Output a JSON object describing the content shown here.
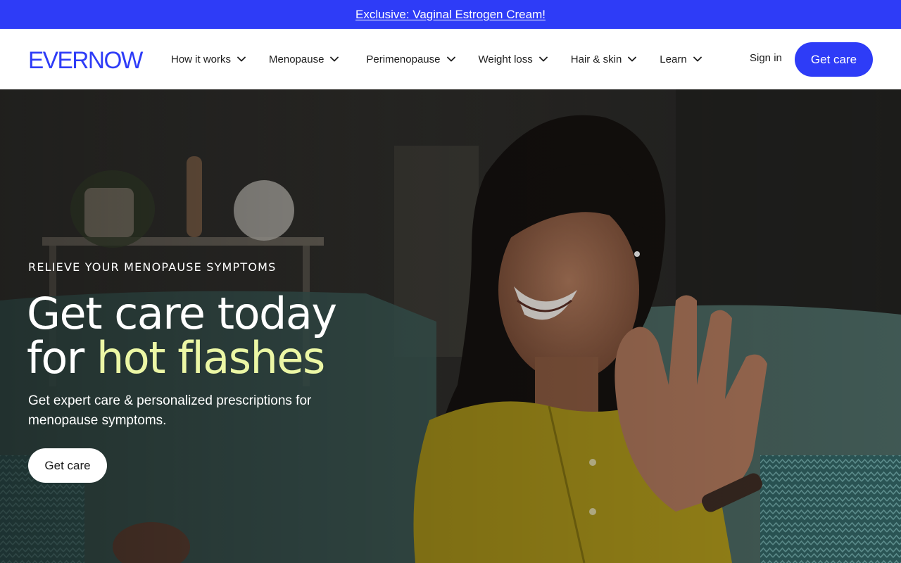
{
  "promo": {
    "text": "Exclusive: Vaginal Estrogen Cream!"
  },
  "brand": {
    "logo": "EVERNOW",
    "color": "#2e3cf7"
  },
  "nav": {
    "items": [
      {
        "label": "How it works",
        "icon": "chevron-down-icon"
      },
      {
        "label": "Menopause",
        "icon": "chevron-down-icon"
      },
      {
        "label": "Perimenopause",
        "icon": "chevron-down-icon"
      },
      {
        "label": "Weight loss",
        "icon": "chevron-down-icon"
      },
      {
        "label": "Hair & skin",
        "icon": "chevron-down-icon"
      },
      {
        "label": "Learn",
        "icon": "chevron-down-icon"
      }
    ],
    "signin_label": "Sign in",
    "cta_label": "Get care"
  },
  "hero": {
    "eyebrow": "RELIEVE YOUR MENOPAUSE SYMPTOMS",
    "headline_line1": "Get care today",
    "headline_prefix": "for ",
    "headline_accent": "hot flashes",
    "accent_color": "#ecf7a5",
    "subtext": "Get expert care & personalized prescriptions for menopause symptoms.",
    "cta_label": "Get care"
  }
}
